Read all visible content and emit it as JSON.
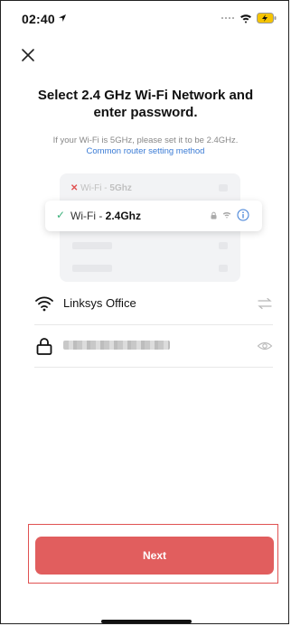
{
  "status_bar": {
    "time": "02:40"
  },
  "header": {
    "close_icon": "close-icon"
  },
  "main": {
    "title": "Select 2.4 GHz Wi-Fi Network and enter password.",
    "subtitle": "If your Wi-Fi is 5GHz, please set it to be 2.4GHz.",
    "link": "Common router setting method"
  },
  "illustration": {
    "row_5g_prefix": "Wi-Fi - ",
    "row_5g_band": "5Ghz",
    "row_24_prefix": "Wi-Fi - ",
    "row_24_band": "2.4Ghz"
  },
  "form": {
    "network_name": "Linksys Office",
    "password_masked": true
  },
  "footer": {
    "next_label": "Next"
  },
  "colors": {
    "primary": "#e15e5e",
    "link": "#3a7bd5",
    "check": "#3bb07a"
  }
}
